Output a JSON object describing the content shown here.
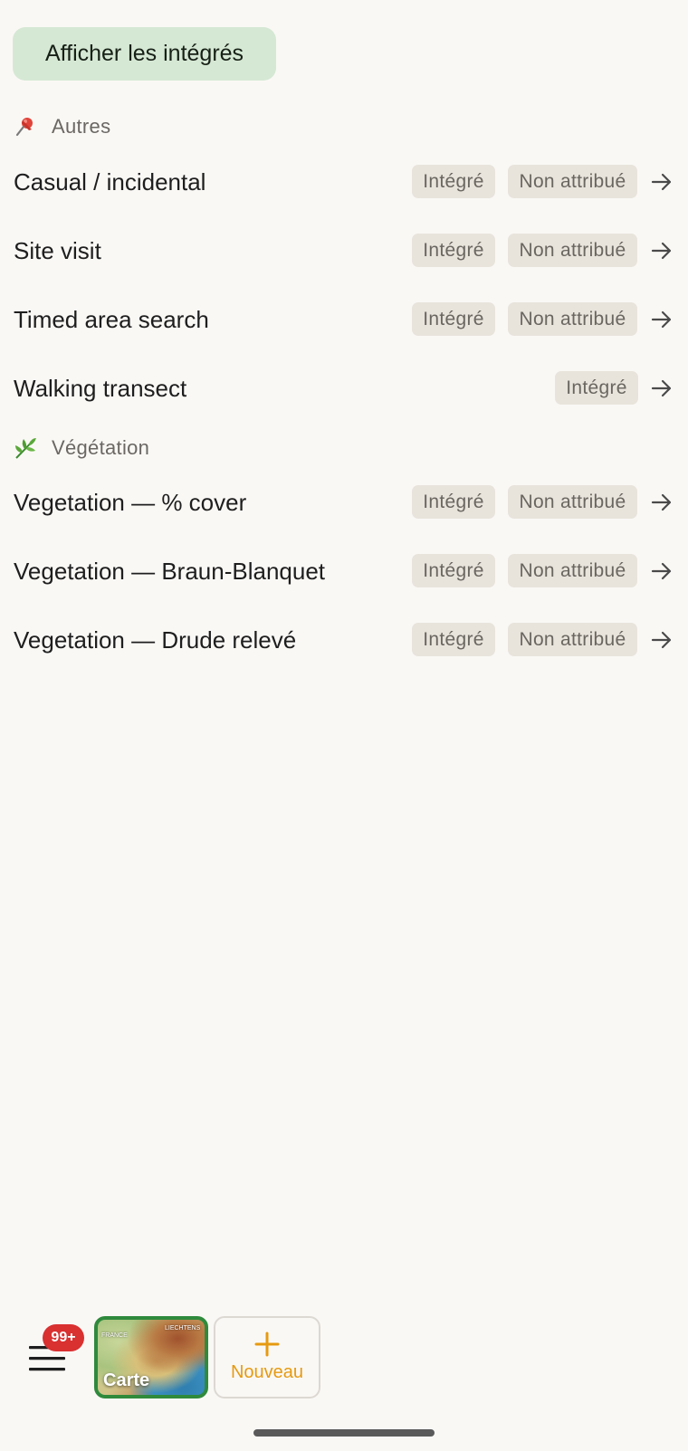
{
  "toggle": {
    "label": "Afficher les intégrés"
  },
  "sections": [
    {
      "icon": "pushpin-icon",
      "emoji": "📌",
      "title": "Autres",
      "items": [
        {
          "title": "Casual / incidental",
          "badges": [
            "Intégré",
            "Non attribué"
          ]
        },
        {
          "title": "Site visit",
          "badges": [
            "Intégré",
            "Non attribué"
          ]
        },
        {
          "title": "Timed area search",
          "badges": [
            "Intégré",
            "Non attribué"
          ]
        },
        {
          "title": "Walking transect",
          "badges": [
            "Intégré"
          ]
        }
      ]
    },
    {
      "icon": "herb-icon",
      "emoji": "🌿",
      "title": "Végétation",
      "items": [
        {
          "title": "Vegetation — % cover",
          "badges": [
            "Intégré",
            "Non attribué"
          ]
        },
        {
          "title": "Vegetation — Braun-Blanquet",
          "badges": [
            "Intégré",
            "Non attribué"
          ]
        },
        {
          "title": "Vegetation — Drude relevé",
          "badges": [
            "Intégré",
            "Non attribué"
          ]
        }
      ]
    }
  ],
  "bottom_bar": {
    "menu_icon": "hamburger-menu-icon",
    "notification_count": "99+",
    "map_button_label": "Carte",
    "map_tiny_labels": [
      "FRANCE",
      "LIECHTENS"
    ],
    "new_button_label": "Nouveau",
    "new_button_icon": "plus-icon"
  },
  "colors": {
    "background": "#faf8f5",
    "toggle_bg": "#d5e8d4",
    "badge_bg": "#e8e4dc",
    "accent_green": "#2f8a3c",
    "accent_orange": "#e69a10",
    "notification_red": "#d93030"
  }
}
